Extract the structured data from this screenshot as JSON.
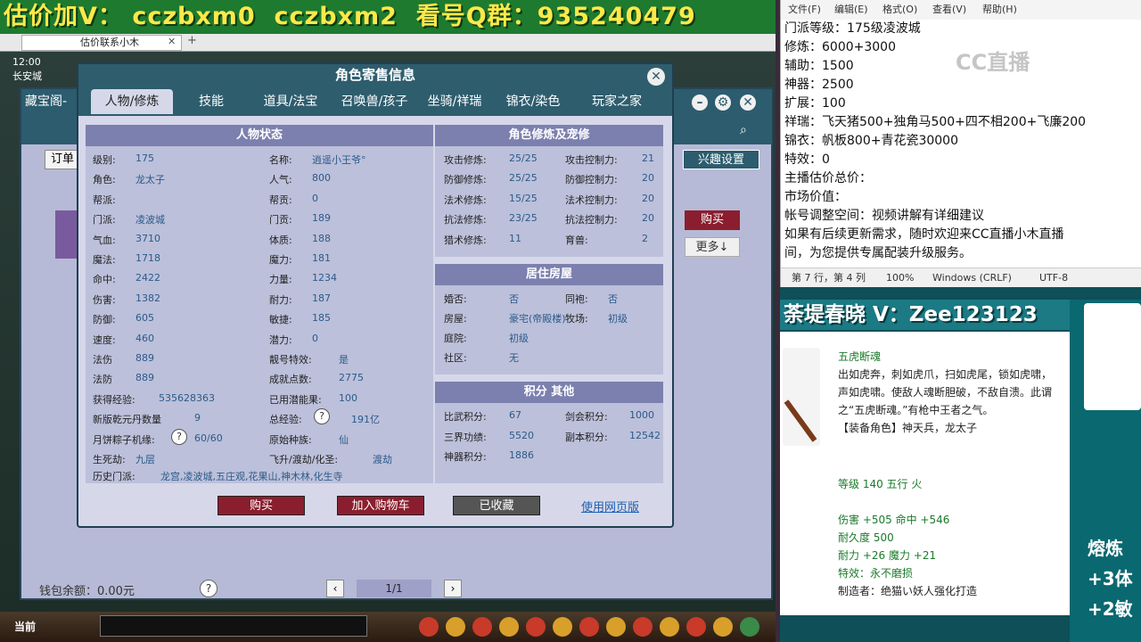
{
  "banner": {
    "prefix": "估价加V：",
    "wx1": "cczbxm0",
    "wx2": "cczbxm2",
    "qq_label": "看号Q群：",
    "qq": "935240479"
  },
  "browser_tab": {
    "title": "估价联系小木",
    "close": "✕",
    "plus": "+"
  },
  "game": {
    "time": "12:00",
    "location": "长安城",
    "window_title": "藏宝阁-",
    "interest_button": "兴趣设置",
    "order_button": "订单",
    "buy_button": "购买",
    "more_button": "更多↓",
    "wallet": "钱包余额：0.00元",
    "help": "?",
    "page_prev": "‹",
    "page_text": "1/1",
    "page_next": "›",
    "bottom_current": "当前"
  },
  "dialog": {
    "title": "角色寄售信息",
    "close": "✕",
    "tabs": [
      "人物/修炼",
      "技能",
      "道具/法宝",
      "召唤兽/孩子",
      "坐骑/祥瑞",
      "锦衣/染色",
      "玩家之家"
    ],
    "status_title": "人物状态",
    "left_col": [
      {
        "label": "级别:",
        "value": "175"
      },
      {
        "label": "角色:",
        "value": "龙太子"
      },
      {
        "label": "帮派:",
        "value": ""
      },
      {
        "label": "门派:",
        "value": "凌波城"
      },
      {
        "label": "气血:",
        "value": "3710"
      },
      {
        "label": "魔法:",
        "value": "1718"
      },
      {
        "label": "命中:",
        "value": "2422"
      },
      {
        "label": "伤害:",
        "value": "1382"
      },
      {
        "label": "防御:",
        "value": "605"
      },
      {
        "label": "速度:",
        "value": "460"
      },
      {
        "label": "法伤",
        "value": "889"
      },
      {
        "label": "法防",
        "value": "889"
      },
      {
        "label": "获得经验:",
        "value": "535628363"
      },
      {
        "label": "新版乾元丹数量",
        "value": "9"
      },
      {
        "label": "月饼粽子机缘:",
        "value": "60/60"
      },
      {
        "label": "生死劫:",
        "value": "九层"
      }
    ],
    "mid_col": [
      {
        "label": "名称:",
        "value": "逍遥小王爷°"
      },
      {
        "label": "人气:",
        "value": "800"
      },
      {
        "label": "帮贡:",
        "value": "0"
      },
      {
        "label": "门贡:",
        "value": "189"
      },
      {
        "label": "体质:",
        "value": "188"
      },
      {
        "label": "魔力:",
        "value": "181"
      },
      {
        "label": "力量:",
        "value": "1234"
      },
      {
        "label": "耐力:",
        "value": "187"
      },
      {
        "label": "敏捷:",
        "value": "185"
      },
      {
        "label": "潜力:",
        "value": "0"
      },
      {
        "label": "靓号特效:",
        "value": "是"
      },
      {
        "label": "成就点数:",
        "value": "2775"
      },
      {
        "label": "已用潜能果:",
        "value": "100"
      },
      {
        "label": "总经验:",
        "value": "191亿"
      },
      {
        "label": "原始种族:",
        "value": "仙"
      },
      {
        "label": "飞升/渡劫/化圣:",
        "value": "渡劫"
      }
    ],
    "history_label": "历史门派:",
    "history_value": "龙宫,凌波城,五庄观,花果山,神木林,化生寺",
    "xiulian_title": "角色修炼及宠修",
    "xiulian": [
      {
        "l1": "攻击修炼:",
        "v1": "25/25",
        "l2": "攻击控制力:",
        "v2": "21"
      },
      {
        "l1": "防御修炼:",
        "v1": "25/25",
        "l2": "防御控制力:",
        "v2": "20"
      },
      {
        "l1": "法术修炼:",
        "v1": "15/25",
        "l2": "法术控制力:",
        "v2": "20"
      },
      {
        "l1": "抗法修炼:",
        "v1": "23/25",
        "l2": "抗法控制力:",
        "v2": "20"
      },
      {
        "l1": "猎术修炼:",
        "v1": "11",
        "l2": "育兽:",
        "v2": "2"
      }
    ],
    "house_title": "居住房屋",
    "house": [
      {
        "l1": "婚否:",
        "v1": "否",
        "l2": "同袍:",
        "v2": "否"
      },
      {
        "l1": "房屋:",
        "v1": "豪宅(帝殿楼)",
        "l2": "牧场:",
        "v2": "初级"
      },
      {
        "l1": "庭院:",
        "v1": "初级",
        "l2": "",
        "v2": ""
      },
      {
        "l1": "社区:",
        "v1": "无",
        "l2": "",
        "v2": ""
      }
    ],
    "score_title": "积分 其他",
    "score": [
      {
        "l1": "比武积分:",
        "v1": "67",
        "l2": "剑会积分:",
        "v2": "1000"
      },
      {
        "l1": "三界功绩:",
        "v1": "5520",
        "l2": "副本积分:",
        "v2": "12542"
      },
      {
        "l1": "神器积分:",
        "v1": "1886",
        "l2": "",
        "v2": ""
      }
    ],
    "btn_buy": "购买",
    "btn_cart": "加入购物车",
    "btn_fav": "已收藏",
    "web_link": "使用网页版",
    "q": "?"
  },
  "notepad": {
    "menu": [
      "文件(F)",
      "编辑(E)",
      "格式(O)",
      "查看(V)",
      "帮助(H)"
    ],
    "lines": [
      "门派等级：175级凌波城",
      "修炼：6000+3000",
      "辅助：1500",
      "神器：2500",
      "扩展：100",
      "祥瑞：飞天猪500+独角马500+四不相200+飞廉200",
      "锦衣：帆板800+青花瓷30000",
      "特效：0",
      "主播估价总价：",
      "市场价值：",
      "帐号调整空间：视频讲解有详细建议",
      "如果有后续更新需求，随时欢迎来CC直播小木直播",
      "间，为您提供专属配装升级服务。"
    ],
    "status": {
      "pos": "第 7 行，第 4 列",
      "zoom": "100%",
      "eol": "Windows (CRLF)",
      "enc": "UTF-8"
    },
    "watermark": "CC直播"
  },
  "stream": {
    "zee_banner": "荼堤春晓  V：Zee123123",
    "item_name": "五虎断魂",
    "item_desc": "出如虎奔，刺如虎爪，扫如虎尾，锁如虎啸，声如虎啸。使敌人魂断胆破，不敌自溃。此谓之“五虎断魂。”有枪中王者之气。",
    "item_equip": "【装备角色】神天兵，龙太子",
    "item_level": "等级 140  五行 火",
    "item_stats": "伤害 +505 命中 +546",
    "item_durability": "耐久度 500",
    "item_extra": "耐力 +26 魔力 +21",
    "item_effect": "特效：永不磨损",
    "item_maker": "制造者：绝猫い妖人强化打造",
    "right_text": "熔炼\n+3体\n+2敏"
  },
  "colors": {
    "banner_bg": "#1e7a2e",
    "banner_text": "#ffe84a",
    "dialog_header": "#2e5d6e",
    "buy_red": "#8b1e2e",
    "stream_teal": "#1b7a84"
  }
}
